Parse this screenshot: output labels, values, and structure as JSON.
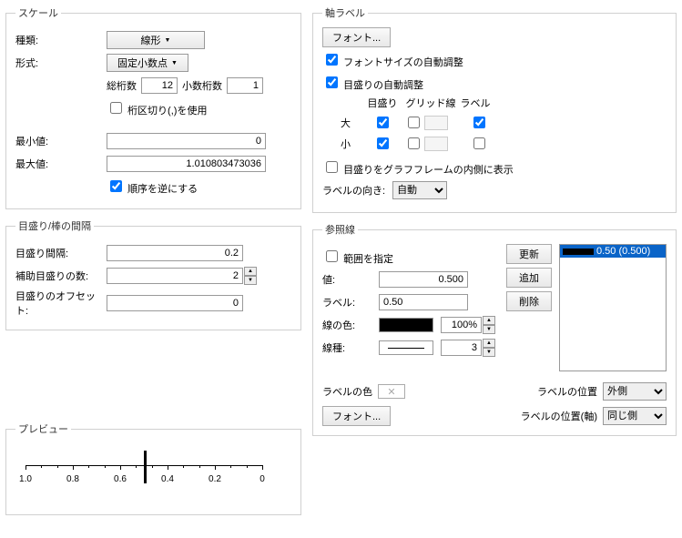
{
  "scale": {
    "legend": "スケール",
    "type_label": "種類:",
    "type_value": "線形",
    "format_label": "形式:",
    "format_value": "固定小数点",
    "total_digits_label": "総桁数",
    "total_digits": "12",
    "decimal_digits_label": "小数桁数",
    "decimal_digits": "1",
    "thousands_sep": "桁区切り(,)を使用",
    "min_label": "最小値:",
    "min_value": "0",
    "max_label": "最大値:",
    "max_value": "1.010803473036",
    "reverse": "順序を逆にする"
  },
  "ticks": {
    "legend": "目盛り/棒の間隔",
    "interval_label": "目盛り間隔:",
    "interval": "0.2",
    "minor_label": "補助目盛りの数:",
    "minor": "2",
    "offset_label": "目盛りのオフセット:",
    "offset": "0"
  },
  "axis_labels": {
    "legend": "軸ラベル",
    "font_btn": "フォント...",
    "auto_font": "フォントサイズの自動調整",
    "auto_tick": "目盛りの自動調整",
    "hd_tick": "目盛り",
    "hd_grid": "グリッド線",
    "hd_label": "ラベル",
    "major": "大",
    "minor": "小",
    "inside": "目盛りをグラフフレームの内側に表示",
    "orient_label": "ラベルの向き:",
    "orient_value": "自動"
  },
  "reflines": {
    "legend": "参照線",
    "range_chk": "範囲を指定",
    "update": "更新",
    "add": "追加",
    "delete": "削除",
    "value_label": "値:",
    "value": "0.500",
    "label_label": "ラベル:",
    "label_value": "0.50",
    "color_label": "線の色:",
    "opacity": "100%",
    "style_label": "線種:",
    "style_num": "3",
    "label_color": "ラベルの色",
    "font_btn": "フォント...",
    "labelpos_label": "ラベルの位置",
    "labelpos_value": "外側",
    "labelpos_axis_label": "ラベルの位置(軸)",
    "labelpos_axis_value": "同じ側",
    "list_item": "0.50 (0.500)"
  },
  "preview": {
    "legend": "プレビュー",
    "ticks": [
      "1.0",
      "0.8",
      "0.6",
      "0.4",
      "0.2",
      "0"
    ]
  }
}
